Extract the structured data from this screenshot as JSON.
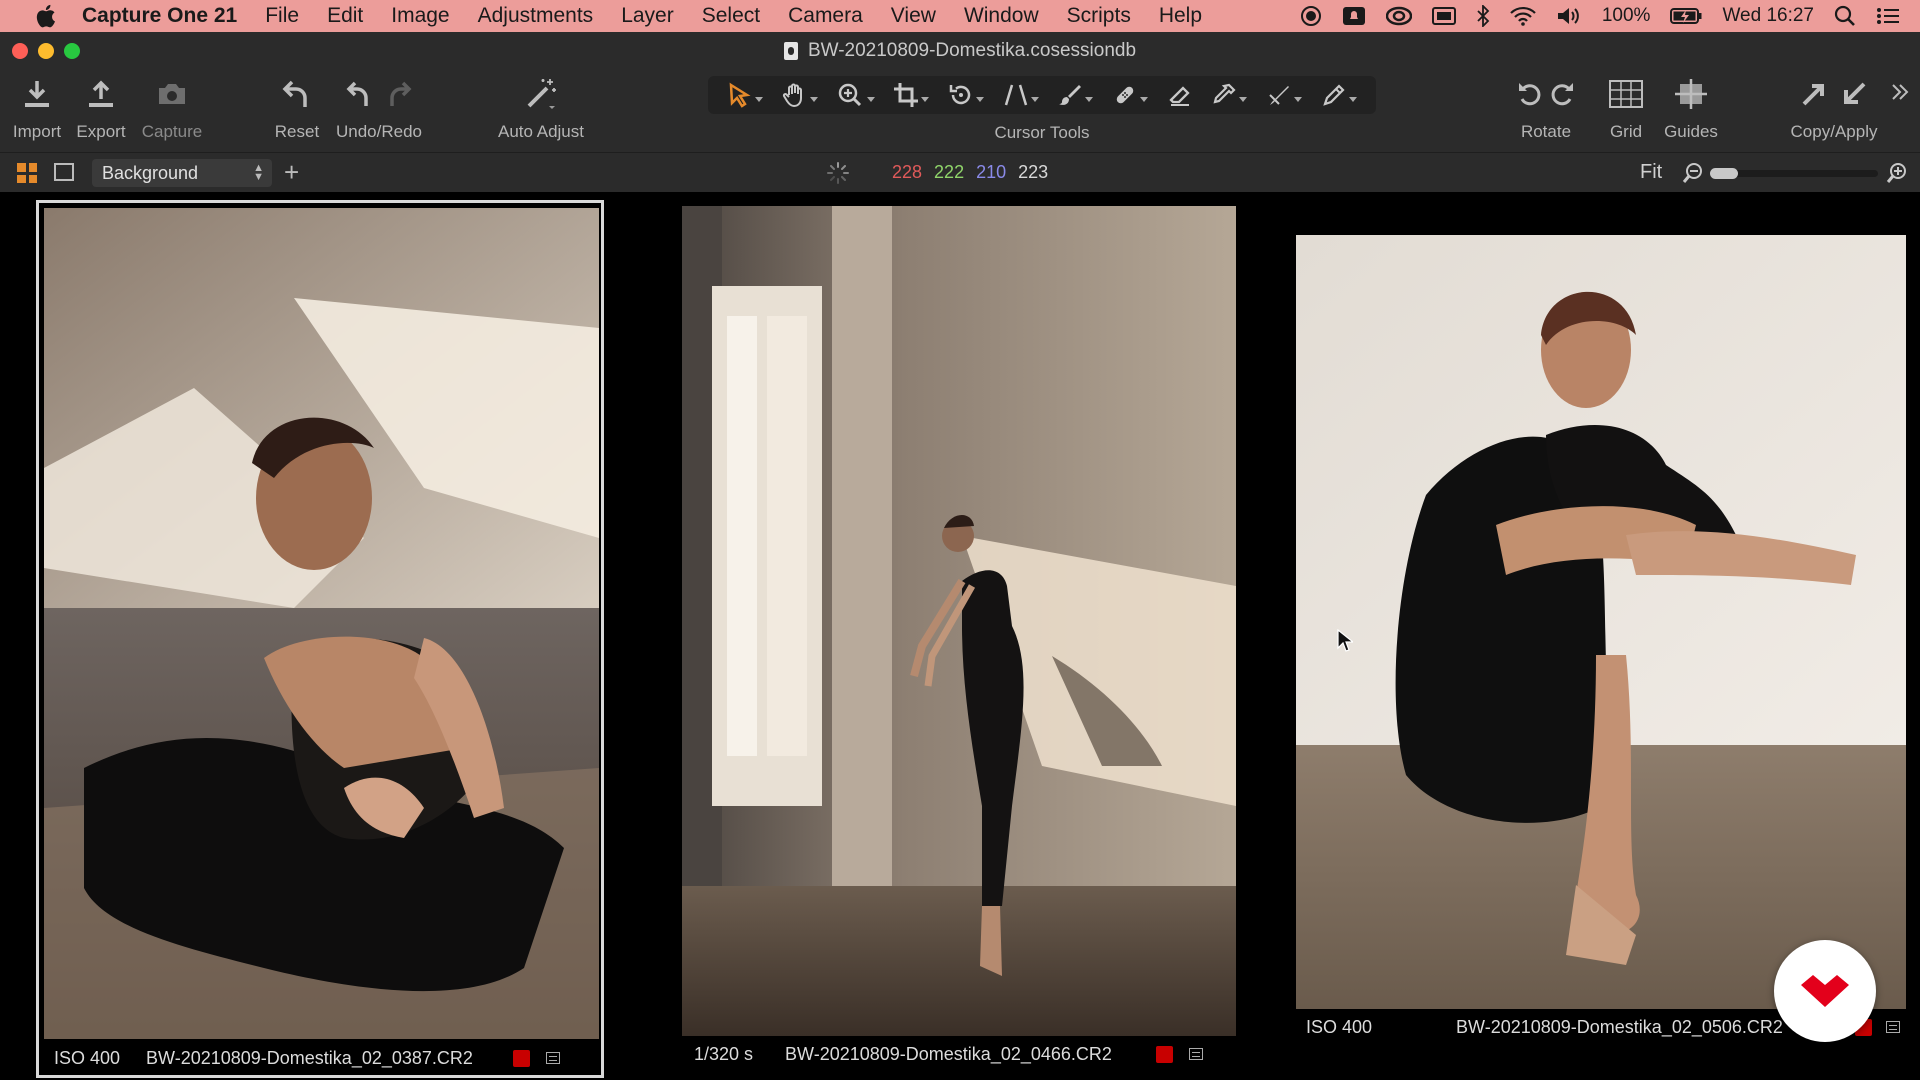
{
  "menubar": {
    "app_name": "Capture One 21",
    "items": [
      "File",
      "Edit",
      "Image",
      "Adjustments",
      "Layer",
      "Select",
      "Camera",
      "View",
      "Window",
      "Scripts",
      "Help"
    ],
    "battery": "100%",
    "clock": "Wed 16:27"
  },
  "window": {
    "title": "BW-20210809-Domestika.cosessiondb"
  },
  "toolbar": {
    "import": "Import",
    "export": "Export",
    "capture": "Capture",
    "reset": "Reset",
    "undo_redo": "Undo/Redo",
    "auto_adjust": "Auto Adjust",
    "cursor_tools": "Cursor Tools",
    "rotate": "Rotate",
    "grid": "Grid",
    "guides": "Guides",
    "copy_apply": "Copy/Apply"
  },
  "viewer": {
    "layer": "Background",
    "rgb": {
      "r": "228",
      "g": "222",
      "b": "210",
      "l": "223"
    },
    "zoom_label": "Fit",
    "zoom_level": 0.0
  },
  "thumbnails": [
    {
      "meta": "ISO 400",
      "filename": "BW-20210809-Domestika_02_0387.CR2",
      "color_tag": "#c80000",
      "selected": true
    },
    {
      "meta": "1/320 s",
      "filename": "BW-20210809-Domestika_02_0466.CR2",
      "color_tag": "#c80000",
      "selected": false
    },
    {
      "meta": "ISO 400",
      "filename": "BW-20210809-Domestika_02_0506.CR2",
      "color_tag": "#c80000",
      "selected": false
    }
  ],
  "colors": {
    "menubar_bg": "#ec9d9a",
    "accent_orange": "#e58a2b",
    "rgb_red": "#e05a5a",
    "rgb_green": "#8fd46a",
    "rgb_blue": "#8a8ae8",
    "brand_red": "#e3001b"
  }
}
